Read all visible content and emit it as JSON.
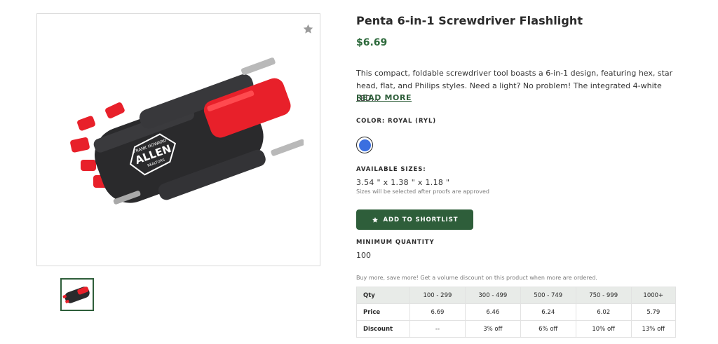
{
  "product": {
    "title": "Penta 6-in-1 Screwdriver Flashlight",
    "price": "$6.69",
    "description": "This compact, foldable screwdriver tool boasts a 6-in-1 design, featuring hex, star head, flat, and Philips styles. Need a light? No problem! The integrated 4-white LED…",
    "read_more": "READ MORE",
    "imprint_lines": [
      "FRANK HOWARD",
      "ALLEN",
      "REALTORS"
    ]
  },
  "color": {
    "label": "COLOR: ROYAL (RYL)",
    "swatch_hex": "#3b6fe0"
  },
  "sizes": {
    "label": "AVAILABLE SIZES:",
    "value": "3.54 \" x 1.38 \" x 1.18 \"",
    "note": "Sizes will be selected after proofs are approved"
  },
  "actions": {
    "shortlist_label": "ADD TO SHORTLIST"
  },
  "minimum": {
    "label": "MINIMUM QUANTITY",
    "value": "100"
  },
  "bulk_note": "Buy more, save more! Get a volume discount on this product when more are ordered.",
  "pricing_table": {
    "header": [
      "Qty",
      "100 - 299",
      "300 - 499",
      "500 - 749",
      "750 - 999",
      "1000+"
    ],
    "rows": [
      [
        "Price",
        "6.69",
        "6.46",
        "6.24",
        "6.02",
        "5.79"
      ],
      [
        "Discount",
        "--",
        "3% off",
        "6% off",
        "10% off",
        "13% off"
      ]
    ]
  },
  "icons": {
    "favorite": "star-icon",
    "shortlist": "star-icon"
  },
  "colors": {
    "accent_green": "#2e5e3a",
    "price_green": "#2e6a3c",
    "product_red": "#e8202a",
    "product_black": "#2a2a2c"
  }
}
